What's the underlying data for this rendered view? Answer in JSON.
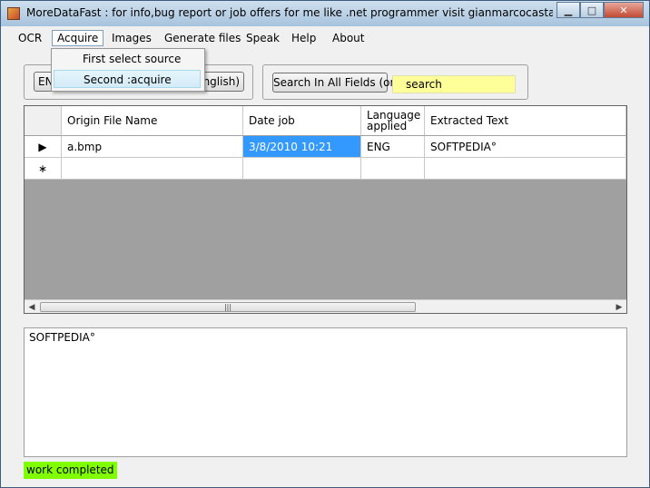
{
  "window": {
    "title": "MoreDataFast : for info,bug report or  job offers for me like .net programmer visit gianmarcocastagna.som..."
  },
  "menu": {
    "items": [
      "OCR",
      "Acquire",
      "Images",
      "Generate files",
      "Speak",
      "Help",
      "About"
    ],
    "active": "Acquire"
  },
  "acquire_menu": {
    "items": [
      "First select source",
      "Second :acquire"
    ],
    "selected": "Second :acquire"
  },
  "toolbar": {
    "language_button_prefix": "EN",
    "language_button_suffix": "english)",
    "search_button": "Search In All Fields (or)",
    "search_value": "search"
  },
  "grid": {
    "columns": [
      "Origin File Name",
      "Date job",
      "Language applied",
      "Extracted Text"
    ],
    "rows": [
      {
        "file": "a.bmp",
        "date": "3/8/2010  10:21",
        "language": "ENG",
        "text": "SOFTPEDIA°"
      }
    ],
    "new_row_marker": "∗",
    "current_row_marker": "▶"
  },
  "output": {
    "text": "SOFTPEDIA°"
  },
  "status": {
    "text": "work completed",
    "color": "#80ff00"
  }
}
